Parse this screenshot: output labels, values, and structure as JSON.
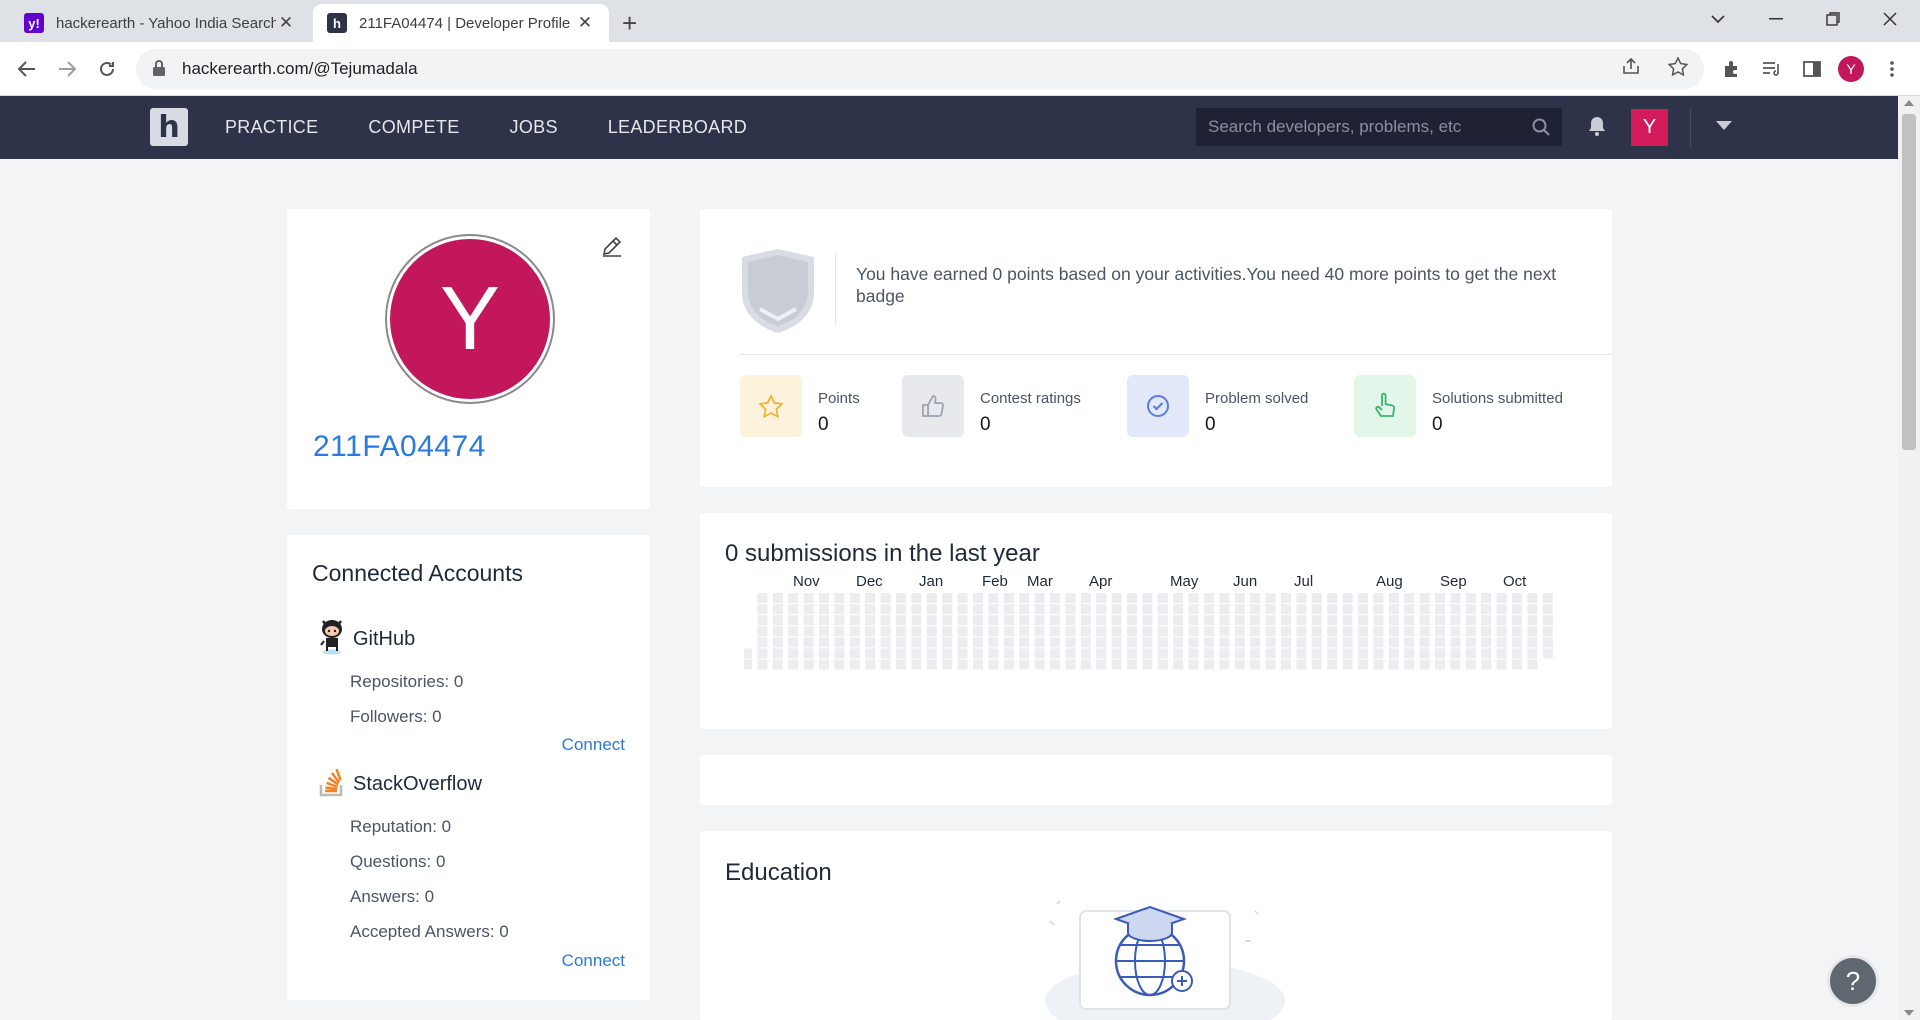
{
  "browser": {
    "tabs": [
      {
        "title": "hackerearth - Yahoo India Search",
        "favicon": "y!",
        "active": false
      },
      {
        "title": "211FA04474 | Developer Profile",
        "favicon": "h",
        "active": true
      }
    ],
    "url": "hackerearth.com/@Tejumadala",
    "profile_initial": "Y"
  },
  "site": {
    "logo": "h",
    "nav": [
      "PRACTICE",
      "COMPETE",
      "JOBS",
      "LEADERBOARD"
    ],
    "search_placeholder": "Search developers, problems, etc",
    "user_initial": "Y",
    "colors": {
      "header": "#2f3349",
      "accent": "#d31b5b",
      "link": "#2a7ae2"
    }
  },
  "profile": {
    "avatar_initial": "Y",
    "username": "211FA04474"
  },
  "connected_accounts": {
    "title": "Connected Accounts",
    "accounts": [
      {
        "name": "GitHub",
        "icon": "github-octocat-icon",
        "stats": [
          "Repositories: 0",
          "Followers: 0"
        ],
        "action": "Connect"
      },
      {
        "name": "StackOverflow",
        "icon": "stackoverflow-icon",
        "stats": [
          "Reputation: 0",
          "Questions: 0",
          "Answers: 0",
          "Accepted Answers: 0"
        ],
        "action": "Connect"
      }
    ]
  },
  "badge": {
    "message": "You have earned 0 points based on your activities.You need 40 more points to get the next badge"
  },
  "stats": [
    {
      "label": "Points",
      "value": "0",
      "icon": "star-icon"
    },
    {
      "label": "Contest ratings",
      "value": "0",
      "icon": "thumbs-up-icon"
    },
    {
      "label": "Problem solved",
      "value": "0",
      "icon": "check-circle-icon"
    },
    {
      "label": "Solutions submitted",
      "value": "0",
      "icon": "pointing-hand-icon"
    }
  ],
  "submissions": {
    "title": "0 submissions in the last year",
    "months": [
      "Nov",
      "Dec",
      "Jan",
      "Feb",
      "Mar",
      "Apr",
      "May",
      "Jun",
      "Jul",
      "Aug",
      "Sep",
      "Oct"
    ]
  },
  "education": {
    "title": "Education"
  },
  "help_label": "?"
}
